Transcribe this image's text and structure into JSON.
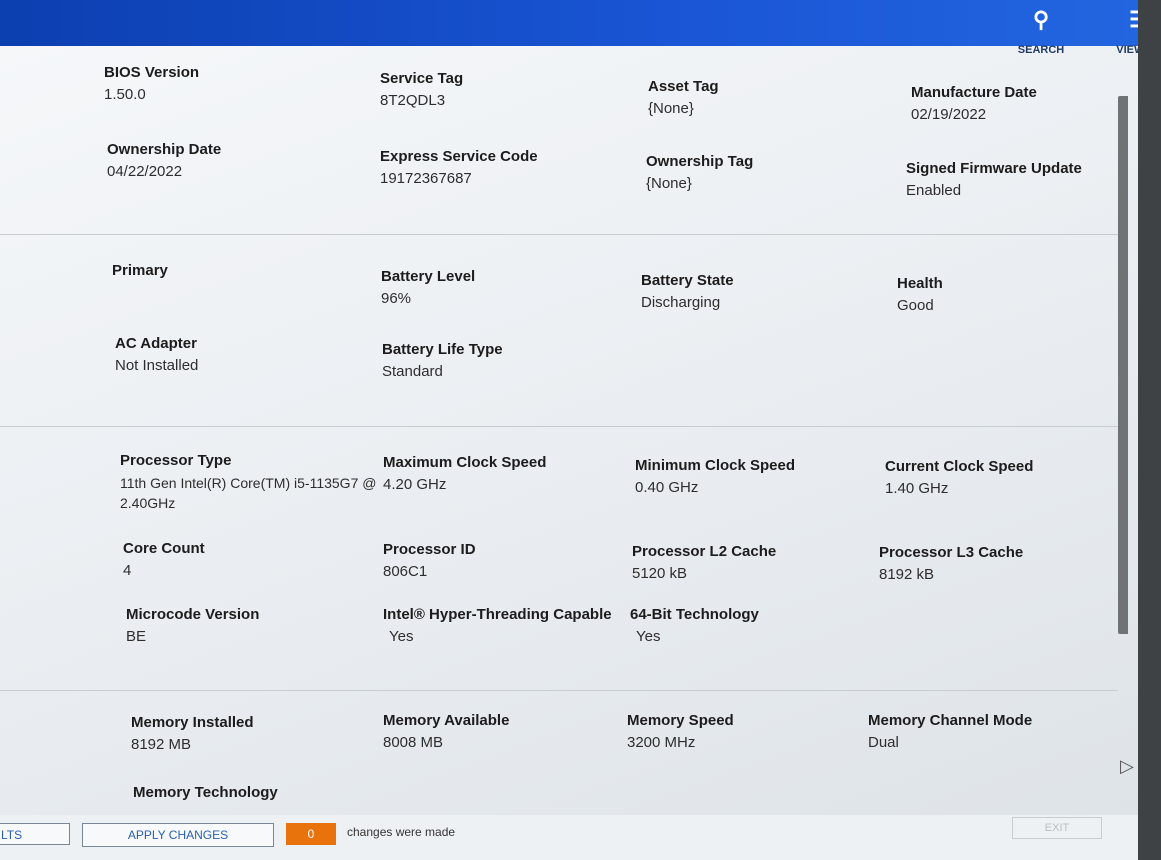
{
  "header": {
    "search_label": "SEARCH",
    "search_icon": "search-icon",
    "view_all_label": "VIEW AL",
    "view_all_icon": "filter-list-icon"
  },
  "system": [
    {
      "label": "BIOS Version",
      "value": "1.50.0"
    },
    {
      "label": "Service Tag",
      "value": "8T2QDL3"
    },
    {
      "label": "Asset Tag",
      "value": "{None}"
    },
    {
      "label": "Manufacture Date",
      "value": "02/19/2022"
    },
    {
      "label": "Ownership Date",
      "value": "04/22/2022"
    },
    {
      "label": "Express Service Code",
      "value": "19172367687"
    },
    {
      "label": "Ownership Tag",
      "value": "{None}"
    },
    {
      "label": "Signed Firmware Update",
      "value": "Enabled"
    }
  ],
  "battery": [
    {
      "label": "Primary",
      "value": ""
    },
    {
      "label": "Battery Level",
      "value": "96%"
    },
    {
      "label": "Battery State",
      "value": "Discharging"
    },
    {
      "label": "Health",
      "value": "Good"
    },
    {
      "label": "AC Adapter",
      "value": "Not Installed"
    },
    {
      "label": "Battery Life Type",
      "value": "Standard"
    }
  ],
  "processor": [
    {
      "label": "Processor Type",
      "value": "11th Gen Intel(R) Core(TM) i5-1135G7 @ 2.40GHz"
    },
    {
      "label": "Maximum Clock Speed",
      "value": "4.20 GHz"
    },
    {
      "label": "Minimum Clock Speed",
      "value": "0.40 GHz"
    },
    {
      "label": "Current Clock Speed",
      "value": "1.40 GHz"
    },
    {
      "label": "Core Count",
      "value": "4"
    },
    {
      "label": "Processor ID",
      "value": "806C1"
    },
    {
      "label": "Processor L2 Cache",
      "value": "5120 kB"
    },
    {
      "label": "Processor L3 Cache",
      "value": "8192 kB"
    },
    {
      "label": "Microcode Version",
      "value": "BE"
    },
    {
      "label": "Intel® Hyper-Threading Capable",
      "value": "Yes"
    },
    {
      "label": "64-Bit Technology",
      "value": "Yes"
    }
  ],
  "memory": [
    {
      "label": "Memory Installed",
      "value": "8192 MB"
    },
    {
      "label": "Memory Available",
      "value": "8008 MB"
    },
    {
      "label": "Memory Speed",
      "value": "3200 MHz"
    },
    {
      "label": "Memory Channel Mode",
      "value": "Dual"
    },
    {
      "label": "Memory Technology",
      "value": ""
    }
  ],
  "footer": {
    "defaults_label": "LTS",
    "apply_label": "APPLY CHANGES",
    "changes_count": "0",
    "changes_text": "changes were made",
    "exit_label": "EXIT",
    "accent_color": "#e8720c"
  }
}
